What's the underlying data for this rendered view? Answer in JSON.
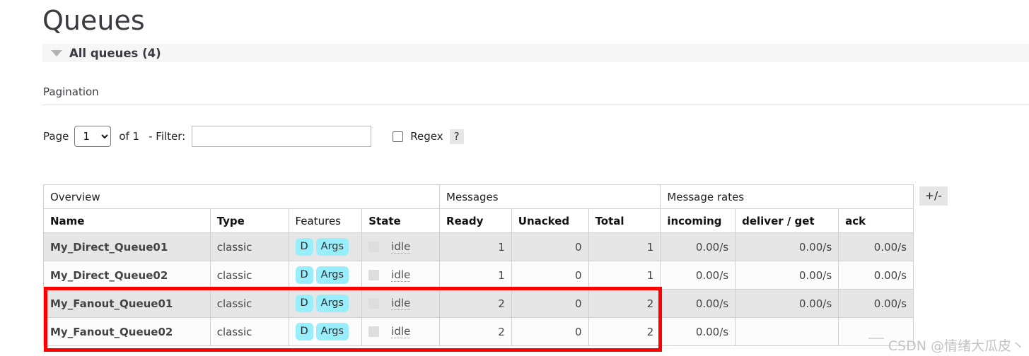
{
  "page": {
    "title": "Queues",
    "section_title": "All queues (4)",
    "collapse_icon": "triangle-down-icon"
  },
  "pagination": {
    "label": "Pagination",
    "page_label": "Page",
    "page_value": "1",
    "page_options": [
      "1"
    ],
    "of_label": "of 1",
    "filter_label": "- Filter:",
    "filter_value": "",
    "filter_placeholder": "",
    "regex_label": "Regex",
    "regex_checked": false,
    "help_label": "?"
  },
  "table": {
    "toggle_columns_label": "+/-",
    "group_headers": [
      {
        "label": "Overview",
        "span": 4
      },
      {
        "label": "Messages",
        "span": 3
      },
      {
        "label": "Message rates",
        "span": 3
      }
    ],
    "columns": [
      {
        "label": "Name",
        "bold": true,
        "align": "left"
      },
      {
        "label": "Type",
        "bold": true,
        "align": "left"
      },
      {
        "label": "Features",
        "bold": false,
        "align": "left"
      },
      {
        "label": "State",
        "bold": true,
        "align": "left"
      },
      {
        "label": "Ready",
        "bold": true,
        "align": "left"
      },
      {
        "label": "Unacked",
        "bold": true,
        "align": "left"
      },
      {
        "label": "Total",
        "bold": true,
        "align": "left"
      },
      {
        "label": "incoming",
        "bold": true,
        "align": "left"
      },
      {
        "label": "deliver / get",
        "bold": true,
        "align": "left"
      },
      {
        "label": "ack",
        "bold": true,
        "align": "left"
      }
    ],
    "rows": [
      {
        "name": "My_Direct_Queue01",
        "type": "classic",
        "features": [
          "D",
          "Args"
        ],
        "state": "idle",
        "ready": "1",
        "unacked": "0",
        "total": "1",
        "incoming": "0.00/s",
        "deliver_get": "0.00/s",
        "ack": "0.00/s",
        "highlighted": false
      },
      {
        "name": "My_Direct_Queue02",
        "type": "classic",
        "features": [
          "D",
          "Args"
        ],
        "state": "idle",
        "ready": "1",
        "unacked": "0",
        "total": "1",
        "incoming": "0.00/s",
        "deliver_get": "0.00/s",
        "ack": "0.00/s",
        "highlighted": false
      },
      {
        "name": "My_Fanout_Queue01",
        "type": "classic",
        "features": [
          "D",
          "Args"
        ],
        "state": "idle",
        "ready": "2",
        "unacked": "0",
        "total": "2",
        "incoming": "0.00/s",
        "deliver_get": "0.00/s",
        "ack": "0.00/s",
        "highlighted": true
      },
      {
        "name": "My_Fanout_Queue02",
        "type": "classic",
        "features": [
          "D",
          "Args"
        ],
        "state": "idle",
        "ready": "2",
        "unacked": "0",
        "total": "2",
        "incoming": "0.00/s",
        "deliver_get": "",
        "ack": "",
        "highlighted": true
      }
    ]
  },
  "annotation": {
    "highlight_color": "#fe0000"
  },
  "watermark": {
    "text": "CSDN @情绪大瓜皮丶"
  },
  "colors": {
    "badge_bg": "#99eefb",
    "row_odd_bg": "#e6e6e6",
    "row_even_bg": "#fcfcfc",
    "section_bar_bg": "#f6f6f6"
  }
}
